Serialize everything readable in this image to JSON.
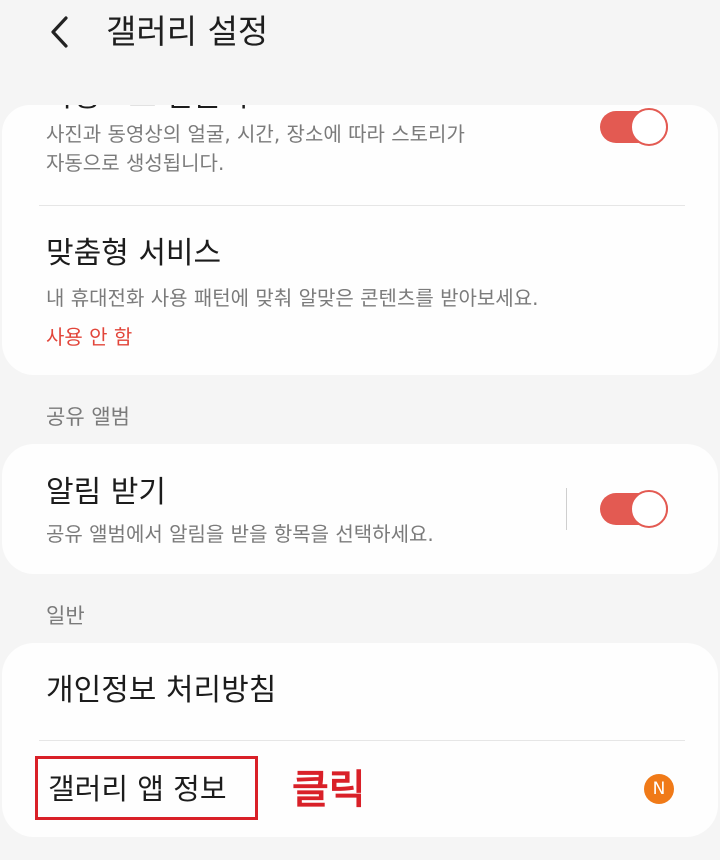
{
  "header": {
    "title": "갤러리 설정",
    "back_icon": "back-arrow-icon"
  },
  "colors": {
    "accent": "#e35a52",
    "status_red": "#e2453a",
    "badge": "#f07a18",
    "annotation_red": "#d92028"
  },
  "story_row": {
    "title_partial": "자동으로 만들기",
    "description_line1": "사진과 동영상의 얼굴, 시간, 장소에 따라 스토리가",
    "description_line2": "자동으로 생성됩니다.",
    "toggle_on": true
  },
  "custom_service_row": {
    "title": "맞춤형 서비스",
    "description": "내 휴대전화 사용 패턴에 맞춰 알맞은 콘텐츠를 받아보세요.",
    "status": "사용 안 함"
  },
  "shared_album_section": {
    "header": "공유 앨범",
    "notifications_row": {
      "title": "알림 받기",
      "description": "공유 앨범에서 알림을 받을 항목을 선택하세요.",
      "toggle_on": true
    }
  },
  "general_section": {
    "header": "일반",
    "privacy_policy_row": {
      "title": "개인정보 처리방침"
    },
    "app_info_row": {
      "title": "갤러리 앱 정보",
      "new_badge": "N"
    }
  },
  "annotation": {
    "label": "클릭"
  }
}
